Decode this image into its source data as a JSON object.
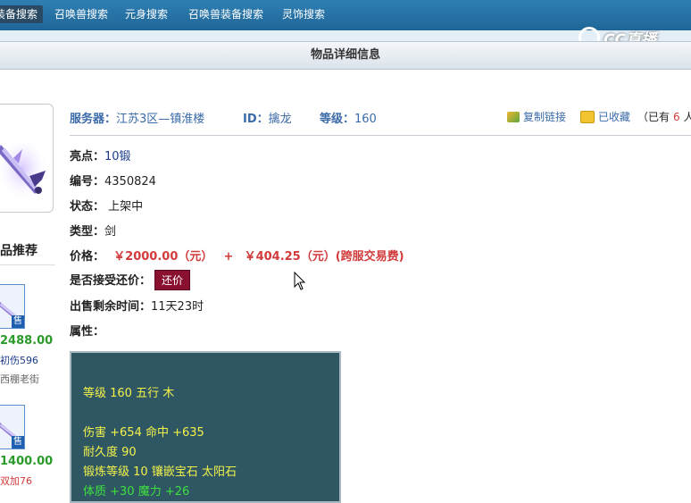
{
  "nav": {
    "tabs": [
      {
        "label": "装备搜索"
      },
      {
        "label": "召唤兽搜索"
      },
      {
        "label": "元身搜索"
      },
      {
        "label": "召唤兽装备搜索"
      },
      {
        "label": "灵饰搜索"
      }
    ]
  },
  "watermark": {
    "text": "CC直播"
  },
  "page_title": "物品详细信息",
  "header": {
    "server_label": "服务器：",
    "server_value": "江苏3区—镇淮楼",
    "id_label": "ID：",
    "id_value": "擒龙",
    "level_label": "等级：",
    "level_value": "160",
    "copy_link": "复制链接",
    "favorited": "已收藏",
    "fav_count_prefix": "（已有",
    "fav_count": "6",
    "fav_count_suffix": "人收"
  },
  "details": {
    "highlight_label": "亮点：",
    "highlight_value": "10锻",
    "serial_label": "编号：",
    "serial_value": "4350824",
    "status_label": "状态：",
    "status_value": "上架中",
    "type_label": "类型：",
    "type_value": "剑",
    "price_label": "价格：",
    "price_main": "￥2000.00（元）",
    "price_plus": "+",
    "price_fee": "￥404.25（元）(跨服交易费)",
    "haggle_label": "是否接受还价：",
    "haggle_button": "还价",
    "time_label": "出售剩余时间：",
    "time_value": "11天23时",
    "attr_label": "属性："
  },
  "attributes": {
    "line1": "等级 160 五行 木",
    "line2": "伤害 +654 命中 +635",
    "line3": "耐久度 90",
    "line4": "锻炼等级 10 镶嵌宝石 太阳石",
    "line5": "体质 +30 魔力 +26"
  },
  "recommend": {
    "title": "品推荐",
    "items": [
      {
        "price": "2488.00",
        "desc": "初伤596",
        "location": "西棚老街",
        "sell_badge": "售"
      },
      {
        "price": "1400.00",
        "desc": "双加76",
        "location": "",
        "sell_badge": "售"
      }
    ]
  },
  "colors": {
    "nav_bg": "#1f6698",
    "price_red": "#d23b3b",
    "haggle_bg": "#8a1030",
    "attr_bg": "#2f5763",
    "attr_yellow": "#f2f24a",
    "attr_green": "#3ee03e",
    "rec_price_green": "#2a9a2a"
  }
}
